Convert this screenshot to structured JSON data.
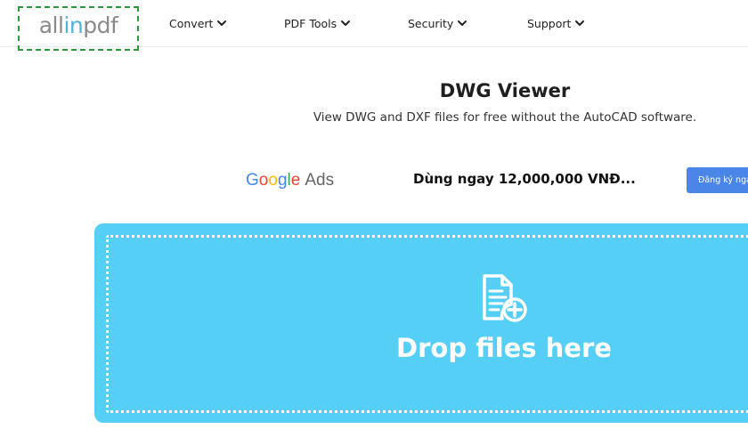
{
  "header": {
    "logo": {
      "part1": "all",
      "part2": "in",
      "part3": "pdf"
    },
    "nav": [
      {
        "label": "Convert"
      },
      {
        "label": "PDF Tools"
      },
      {
        "label": "Security"
      },
      {
        "label": "Support"
      }
    ]
  },
  "hero": {
    "title": "DWG Viewer",
    "subtitle": "View DWG and DXF files for free without the AutoCAD software."
  },
  "ad": {
    "brand_google": [
      "G",
      "o",
      "o",
      "g",
      "l",
      "e"
    ],
    "brand_ads": "Ads",
    "text": "Dùng ngay 12,000,000 VNĐ...",
    "button_label": "Đăng ký ngay"
  },
  "dropzone": {
    "label": "Drop files here",
    "icon": "file-add-icon"
  },
  "colors": {
    "dropzone_bg": "#56cff7",
    "logo_accent": "#4fb3d9",
    "ad_button": "#4a86e8",
    "logo_border": "#2a9d3a"
  }
}
